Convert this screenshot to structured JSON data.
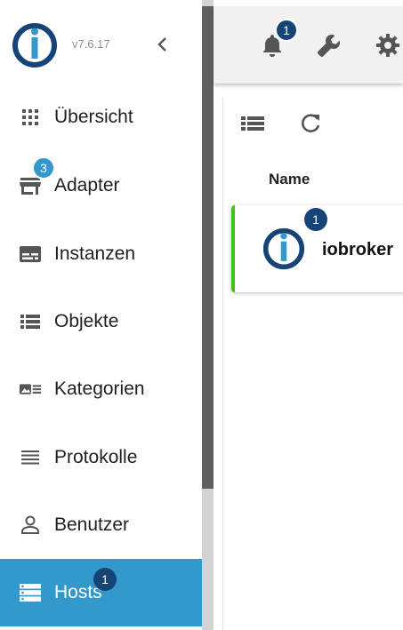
{
  "app": {
    "version": "v7.6.17",
    "logo": "iobroker-logo-icon",
    "colors": {
      "accent": "#3399cc",
      "brand_dark": "#164477",
      "status_ok": "#3ec21d"
    }
  },
  "header": {
    "notifications_badge": "1",
    "icons": [
      "bell-icon",
      "wrench-icon",
      "settings-icon"
    ]
  },
  "sidebar": {
    "collapse_icon": "chevron-left-icon",
    "items": [
      {
        "label": "Übersicht",
        "icon": "apps-grid-icon",
        "badge": ""
      },
      {
        "label": "Adapter",
        "icon": "store-icon",
        "badge": "3"
      },
      {
        "label": "Instanzen",
        "icon": "instances-icon",
        "badge": ""
      },
      {
        "label": "Objekte",
        "icon": "list-icon",
        "badge": ""
      },
      {
        "label": "Kategorien",
        "icon": "enum-icon",
        "badge": ""
      },
      {
        "label": "Protokolle",
        "icon": "logs-icon",
        "badge": ""
      },
      {
        "label": "Benutzer",
        "icon": "user-icon",
        "badge": ""
      },
      {
        "label": "Hosts",
        "icon": "hosts-icon",
        "badge": "1",
        "active": true
      }
    ]
  },
  "main": {
    "toolbar_icons": [
      "list-view-icon",
      "refresh-icon"
    ],
    "table": {
      "columns": [
        "Name"
      ],
      "rows": [
        {
          "name": "iobroker",
          "badge": "1"
        }
      ]
    }
  }
}
